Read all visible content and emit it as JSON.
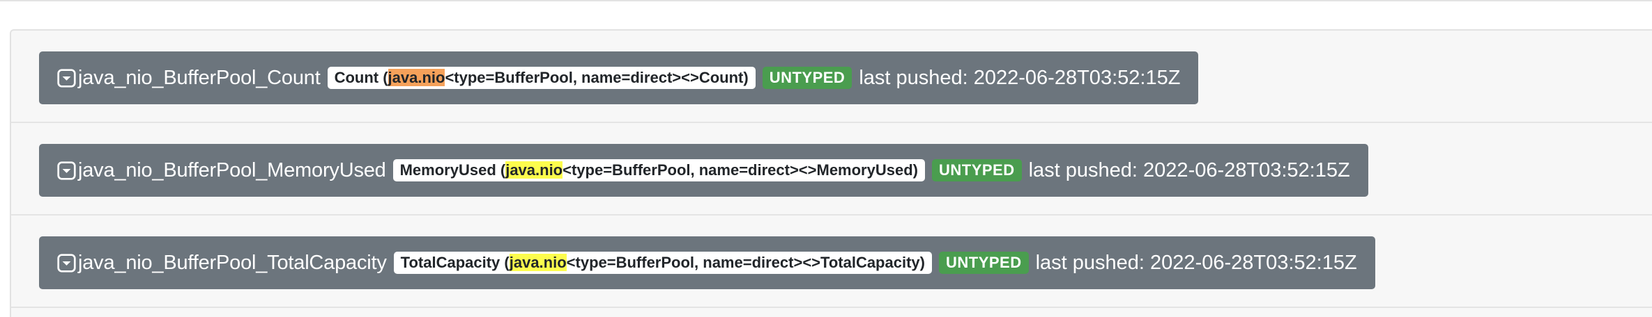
{
  "metrics": [
    {
      "name": "java_nio_BufferPool_Count",
      "help_prefix": "Count (",
      "help_highlight": "java.nio",
      "help_suffix": "<type=BufferPool, name=direct><>Count)",
      "highlight_color": "orange",
      "type": "UNTYPED",
      "last_pushed": "last pushed: 2022-06-28T03:52:15Z"
    },
    {
      "name": "java_nio_BufferPool_MemoryUsed",
      "help_prefix": "MemoryUsed (",
      "help_highlight": "java.nio",
      "help_suffix": "<type=BufferPool, name=direct><>MemoryUsed)",
      "highlight_color": "yellow",
      "type": "UNTYPED",
      "last_pushed": "last pushed: 2022-06-28T03:52:15Z"
    },
    {
      "name": "java_nio_BufferPool_TotalCapacity",
      "help_prefix": "TotalCapacity (",
      "help_highlight": "java.nio",
      "help_suffix": "<type=BufferPool, name=direct><>TotalCapacity)",
      "highlight_color": "yellow",
      "type": "UNTYPED",
      "last_pushed": "last pushed: 2022-06-28T03:52:15Z"
    }
  ],
  "icons": {
    "toggle": "collapse-toggle-icon"
  },
  "colors": {
    "header_bg": "#6c757d",
    "type_badge": "#4a9d4f",
    "highlight_orange": "#f5a15a",
    "highlight_yellow": "#fdfd4d"
  }
}
